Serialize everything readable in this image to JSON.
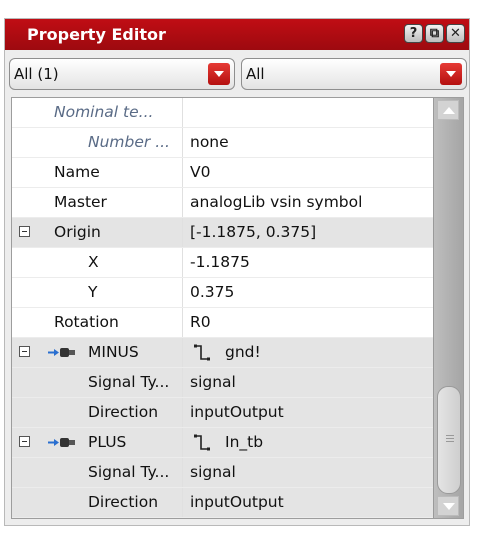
{
  "window": {
    "title": "Property Editor",
    "buttons": {
      "help": "?",
      "float": "⧉",
      "close": "✕"
    }
  },
  "filters": {
    "left": {
      "value": "All (1)"
    },
    "right": {
      "value": "All"
    }
  },
  "rows": [
    {
      "name": "Nominal te...",
      "value": "",
      "style": "italic",
      "indent": 1,
      "shade": false
    },
    {
      "name": "Number ...",
      "value": "none",
      "style": "italic",
      "indent": 2,
      "shade": false
    },
    {
      "name": "Name",
      "value": "V0",
      "indent": 1,
      "shade": false
    },
    {
      "name": "Master",
      "value": "analogLib vsin symbol",
      "indent": 1,
      "shade": false
    },
    {
      "name": "Origin",
      "value": "[-1.1875, 0.375]",
      "indent": 1,
      "shade": true,
      "expander": true
    },
    {
      "name": "X",
      "value": "-1.1875",
      "indent": 2,
      "shade": false
    },
    {
      "name": "Y",
      "value": "0.375",
      "indent": 2,
      "shade": false
    },
    {
      "name": "Rotation",
      "value": "R0",
      "indent": 1,
      "shade": false
    },
    {
      "name": "MINUS",
      "value": "gnd!",
      "indent": 2,
      "shade": true,
      "expander": true,
      "plug_icon": true,
      "net_icon": true
    },
    {
      "name": "Signal Ty...",
      "value": "signal",
      "indent": 2,
      "shade": true
    },
    {
      "name": "Direction",
      "value": "inputOutput",
      "indent": 2,
      "shade": true
    },
    {
      "name": "PLUS",
      "value": "In_tb",
      "indent": 2,
      "shade": true,
      "expander": true,
      "plug_icon": true,
      "net_icon": true
    },
    {
      "name": "Signal Ty...",
      "value": "signal",
      "indent": 2,
      "shade": true
    },
    {
      "name": "Direction",
      "value": "inputOutput",
      "indent": 2,
      "shade": true
    }
  ],
  "colors": {
    "title_bar": "#b40d12",
    "combo_arrow": "#d0241f",
    "shade_row": "#e4e4e4",
    "italic_text": "#5a6b86"
  },
  "icons": {
    "expander": "collapse-box-icon",
    "terminal": "plug-icon",
    "net": "net-wire-icon"
  }
}
